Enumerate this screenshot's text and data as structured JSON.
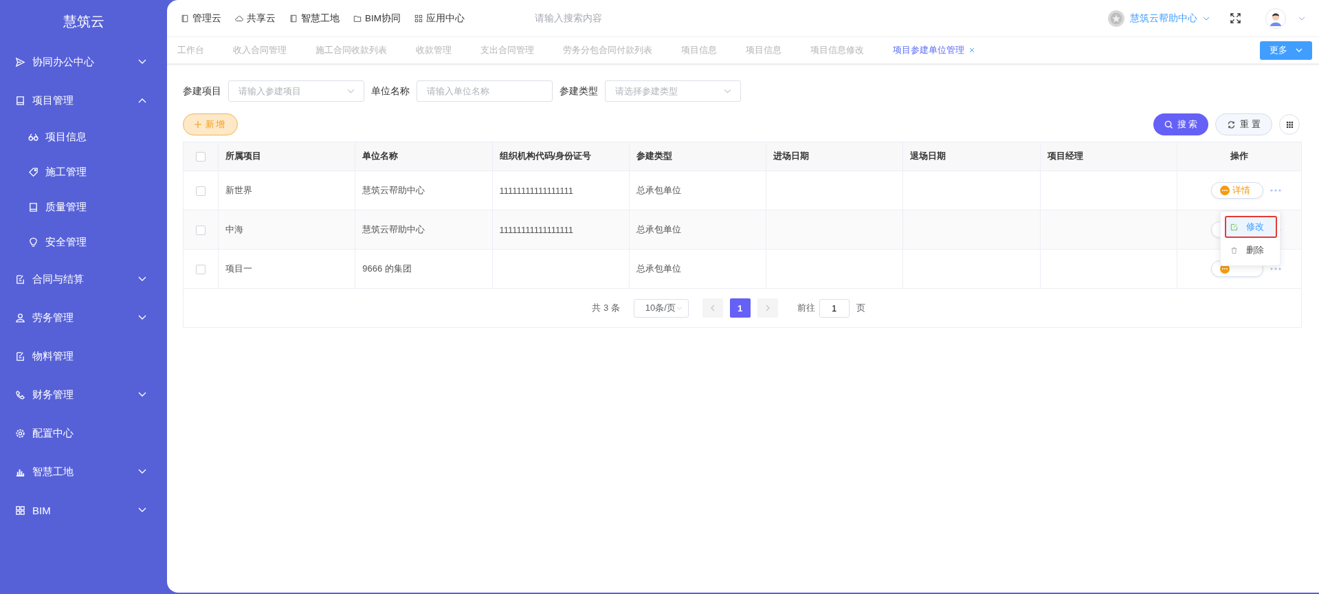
{
  "sidebar": {
    "title": "慧筑云",
    "items": [
      {
        "label": "协同办公中心",
        "expanded": false
      },
      {
        "label": "项目管理",
        "expanded": true,
        "children": [
          {
            "label": "项目信息"
          },
          {
            "label": "施工管理"
          },
          {
            "label": "质量管理"
          },
          {
            "label": "安全管理"
          }
        ]
      },
      {
        "label": "合同与结算",
        "expanded": false
      },
      {
        "label": "劳务管理",
        "expanded": false
      },
      {
        "label": "物料管理"
      },
      {
        "label": "财务管理",
        "expanded": false
      },
      {
        "label": "配置中心"
      },
      {
        "label": "智慧工地",
        "expanded": false
      },
      {
        "label": "BIM",
        "expanded": false
      }
    ]
  },
  "top_nav": {
    "links": [
      {
        "label": "管理云"
      },
      {
        "label": "共享云"
      },
      {
        "label": "智慧工地"
      },
      {
        "label": "BIM协同"
      },
      {
        "label": "应用中心"
      }
    ],
    "search": {
      "placeholder": "请输入搜索内容"
    },
    "help_center": "慧筑云帮助中心"
  },
  "tabs": [
    {
      "label": "工作台",
      "selected": false
    },
    {
      "label": "收入合同管理",
      "selected": false
    },
    {
      "label": "施工合同收款列表",
      "selected": false
    },
    {
      "label": "收款管理",
      "selected": false
    },
    {
      "label": "支出合同管理",
      "selected": false
    },
    {
      "label": "劳务分包合同付款列表",
      "selected": false
    },
    {
      "label": "项目信息",
      "selected": false
    },
    {
      "label": "项目信息",
      "selected": false
    },
    {
      "label": "项目信息修改",
      "selected": false
    },
    {
      "label": "项目参建单位管理",
      "selected": true
    }
  ],
  "more_button": "更多",
  "filters": [
    {
      "label": "参建项目",
      "kind": "select",
      "placeholder": "请输入参建项目"
    },
    {
      "label": "单位名称",
      "kind": "input",
      "placeholder": "请输入单位名称"
    },
    {
      "label": "参建类型",
      "kind": "select",
      "placeholder": "请选择参建类型"
    }
  ],
  "add_button": "新增",
  "search_button": "搜 索",
  "reset_button": "重 置",
  "table": {
    "columns": [
      "所属项目",
      "单位名称",
      "组织机构代码/身份证号",
      "参建类型",
      "进场日期",
      "退场日期",
      "项目经理",
      "操作"
    ],
    "rows": [
      {
        "checked": false,
        "cells": [
          "新世界",
          "慧筑云帮助中心",
          "11111111111111111",
          "总承包单位",
          "",
          "",
          ""
        ],
        "action": "详情"
      },
      {
        "checked": false,
        "cells": [
          "中海",
          "慧筑云帮助中心",
          "11111111111111111",
          "总承包单位",
          "",
          "",
          ""
        ]
      },
      {
        "checked": false,
        "cells": [
          "项目一",
          "9666 的集团",
          "",
          "总承包单位",
          "",
          "",
          ""
        ]
      }
    ],
    "header_checked": false
  },
  "row_menu": [
    {
      "label": "修改",
      "kind": "edit",
      "selected": true
    },
    {
      "label": "删除",
      "kind": "delete",
      "selected": false
    }
  ],
  "pagination": {
    "total": "共 3 条",
    "page_size": "10条/页",
    "pages": [
      {
        "label": "1",
        "selected": true
      }
    ],
    "goto_label": "前往",
    "goto_value": "1",
    "goto_suffix": "页"
  }
}
